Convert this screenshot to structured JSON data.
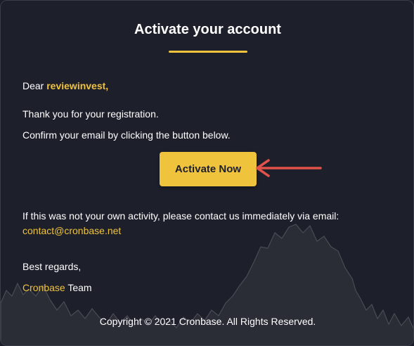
{
  "email": {
    "title": "Activate your account",
    "greeting_prefix": "Dear ",
    "username": "reviewinvest,",
    "thanks": "Thank you for your registration.",
    "instruction": "Confirm your email by clicking the button below.",
    "button_label": "Activate Now",
    "warning": "If this was not your own activity, please contact us immediately via email:",
    "contact_email": "contact@cronbase.net",
    "closing": "Best regards,",
    "brand": "Cronbase",
    "team_suffix": " Team",
    "copyright": "Copyright © 2021 Cronbase. All Rights Reserved."
  },
  "colors": {
    "background": "#1d1f2b",
    "accent": "#f0c33c",
    "button": "#f0c33c",
    "arrow": "#e0524a",
    "chart": "#2b2d37"
  },
  "icons": {
    "annotation": "red-arrow-icon",
    "background": "chart-silhouette"
  }
}
